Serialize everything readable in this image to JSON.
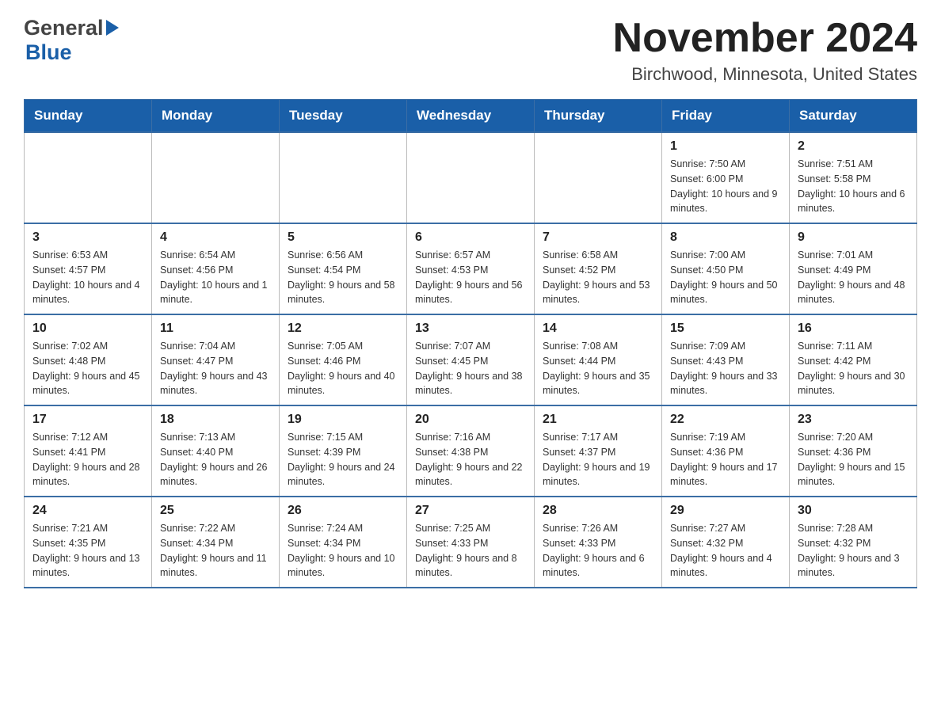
{
  "header": {
    "logo_general": "General",
    "logo_blue": "Blue",
    "title": "November 2024",
    "subtitle": "Birchwood, Minnesota, United States"
  },
  "weekdays": [
    "Sunday",
    "Monday",
    "Tuesday",
    "Wednesday",
    "Thursday",
    "Friday",
    "Saturday"
  ],
  "weeks": [
    [
      {
        "day": "",
        "info": ""
      },
      {
        "day": "",
        "info": ""
      },
      {
        "day": "",
        "info": ""
      },
      {
        "day": "",
        "info": ""
      },
      {
        "day": "",
        "info": ""
      },
      {
        "day": "1",
        "info": "Sunrise: 7:50 AM\nSunset: 6:00 PM\nDaylight: 10 hours and 9 minutes."
      },
      {
        "day": "2",
        "info": "Sunrise: 7:51 AM\nSunset: 5:58 PM\nDaylight: 10 hours and 6 minutes."
      }
    ],
    [
      {
        "day": "3",
        "info": "Sunrise: 6:53 AM\nSunset: 4:57 PM\nDaylight: 10 hours and 4 minutes."
      },
      {
        "day": "4",
        "info": "Sunrise: 6:54 AM\nSunset: 4:56 PM\nDaylight: 10 hours and 1 minute."
      },
      {
        "day": "5",
        "info": "Sunrise: 6:56 AM\nSunset: 4:54 PM\nDaylight: 9 hours and 58 minutes."
      },
      {
        "day": "6",
        "info": "Sunrise: 6:57 AM\nSunset: 4:53 PM\nDaylight: 9 hours and 56 minutes."
      },
      {
        "day": "7",
        "info": "Sunrise: 6:58 AM\nSunset: 4:52 PM\nDaylight: 9 hours and 53 minutes."
      },
      {
        "day": "8",
        "info": "Sunrise: 7:00 AM\nSunset: 4:50 PM\nDaylight: 9 hours and 50 minutes."
      },
      {
        "day": "9",
        "info": "Sunrise: 7:01 AM\nSunset: 4:49 PM\nDaylight: 9 hours and 48 minutes."
      }
    ],
    [
      {
        "day": "10",
        "info": "Sunrise: 7:02 AM\nSunset: 4:48 PM\nDaylight: 9 hours and 45 minutes."
      },
      {
        "day": "11",
        "info": "Sunrise: 7:04 AM\nSunset: 4:47 PM\nDaylight: 9 hours and 43 minutes."
      },
      {
        "day": "12",
        "info": "Sunrise: 7:05 AM\nSunset: 4:46 PM\nDaylight: 9 hours and 40 minutes."
      },
      {
        "day": "13",
        "info": "Sunrise: 7:07 AM\nSunset: 4:45 PM\nDaylight: 9 hours and 38 minutes."
      },
      {
        "day": "14",
        "info": "Sunrise: 7:08 AM\nSunset: 4:44 PM\nDaylight: 9 hours and 35 minutes."
      },
      {
        "day": "15",
        "info": "Sunrise: 7:09 AM\nSunset: 4:43 PM\nDaylight: 9 hours and 33 minutes."
      },
      {
        "day": "16",
        "info": "Sunrise: 7:11 AM\nSunset: 4:42 PM\nDaylight: 9 hours and 30 minutes."
      }
    ],
    [
      {
        "day": "17",
        "info": "Sunrise: 7:12 AM\nSunset: 4:41 PM\nDaylight: 9 hours and 28 minutes."
      },
      {
        "day": "18",
        "info": "Sunrise: 7:13 AM\nSunset: 4:40 PM\nDaylight: 9 hours and 26 minutes."
      },
      {
        "day": "19",
        "info": "Sunrise: 7:15 AM\nSunset: 4:39 PM\nDaylight: 9 hours and 24 minutes."
      },
      {
        "day": "20",
        "info": "Sunrise: 7:16 AM\nSunset: 4:38 PM\nDaylight: 9 hours and 22 minutes."
      },
      {
        "day": "21",
        "info": "Sunrise: 7:17 AM\nSunset: 4:37 PM\nDaylight: 9 hours and 19 minutes."
      },
      {
        "day": "22",
        "info": "Sunrise: 7:19 AM\nSunset: 4:36 PM\nDaylight: 9 hours and 17 minutes."
      },
      {
        "day": "23",
        "info": "Sunrise: 7:20 AM\nSunset: 4:36 PM\nDaylight: 9 hours and 15 minutes."
      }
    ],
    [
      {
        "day": "24",
        "info": "Sunrise: 7:21 AM\nSunset: 4:35 PM\nDaylight: 9 hours and 13 minutes."
      },
      {
        "day": "25",
        "info": "Sunrise: 7:22 AM\nSunset: 4:34 PM\nDaylight: 9 hours and 11 minutes."
      },
      {
        "day": "26",
        "info": "Sunrise: 7:24 AM\nSunset: 4:34 PM\nDaylight: 9 hours and 10 minutes."
      },
      {
        "day": "27",
        "info": "Sunrise: 7:25 AM\nSunset: 4:33 PM\nDaylight: 9 hours and 8 minutes."
      },
      {
        "day": "28",
        "info": "Sunrise: 7:26 AM\nSunset: 4:33 PM\nDaylight: 9 hours and 6 minutes."
      },
      {
        "day": "29",
        "info": "Sunrise: 7:27 AM\nSunset: 4:32 PM\nDaylight: 9 hours and 4 minutes."
      },
      {
        "day": "30",
        "info": "Sunrise: 7:28 AM\nSunset: 4:32 PM\nDaylight: 9 hours and 3 minutes."
      }
    ]
  ]
}
